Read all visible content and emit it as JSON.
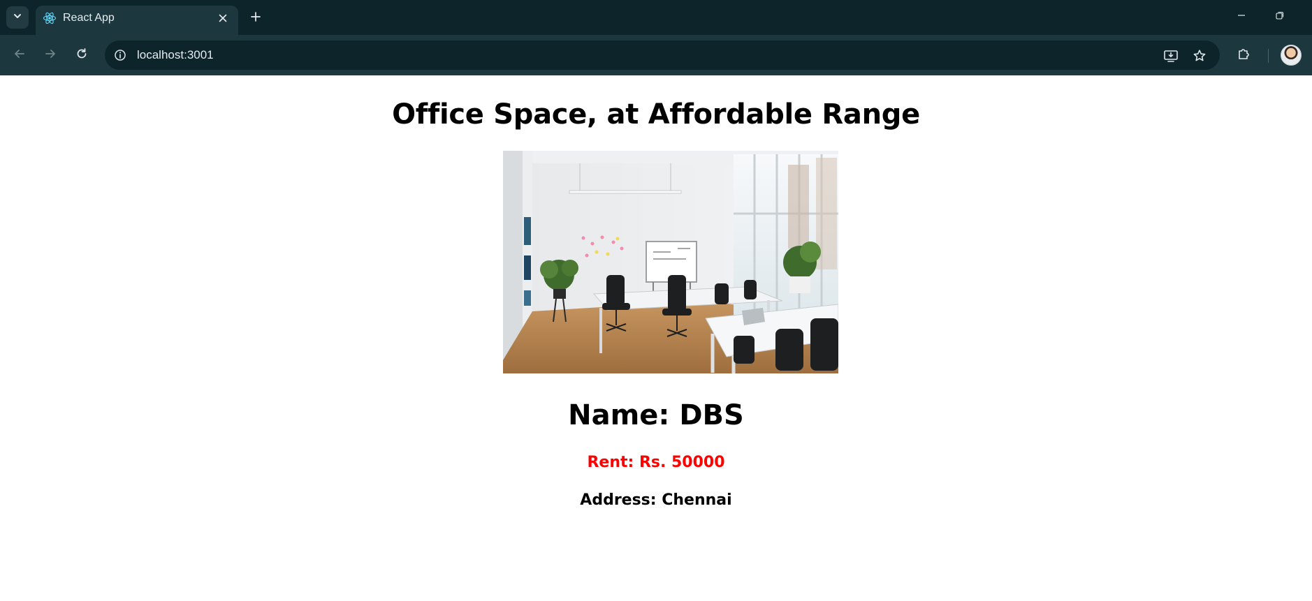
{
  "browser": {
    "tab_title": "React App",
    "url": "localhost:3001",
    "colors": {
      "frame": "#0e242b",
      "toolbar": "#1d373f",
      "icon": "#c4d0d3"
    },
    "icons": {
      "tab_search": "chevron-down-icon",
      "tab_favicon": "react-logo-icon",
      "tab_close": "close-icon",
      "new_tab": "plus-icon",
      "back": "arrow-left-icon",
      "forward": "arrow-right-icon",
      "reload": "reload-icon",
      "site_info": "info-icon",
      "install_app": "install-app-icon",
      "bookmark": "star-icon",
      "extensions": "puzzle-icon",
      "minimize": "minimize-icon",
      "restore": "restore-icon",
      "profile": "avatar"
    }
  },
  "page": {
    "title": "Office Space, at Affordable Range",
    "image_alt": "Office",
    "office": {
      "name": "Name: DBS",
      "rent": "Rent: Rs. 50000",
      "address": "Address: Chennai"
    },
    "colors": {
      "rent_text": "#ff0000",
      "text": "#000000"
    }
  }
}
